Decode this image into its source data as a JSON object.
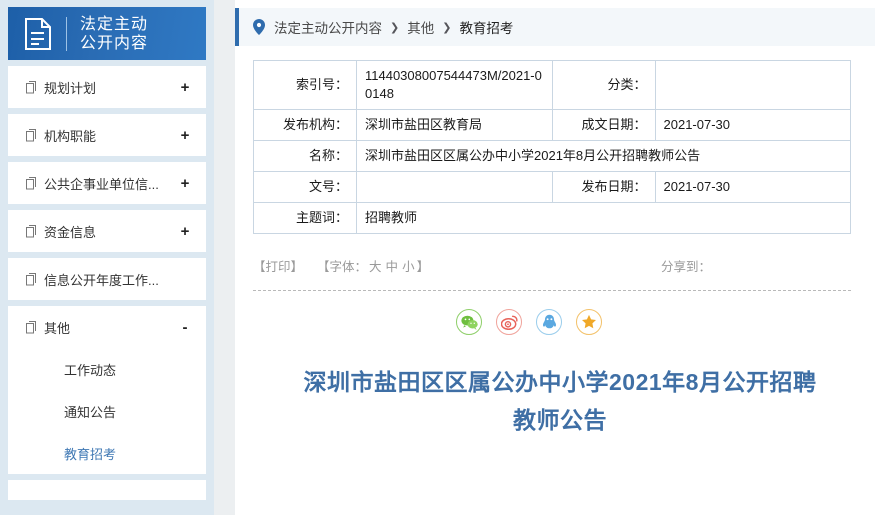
{
  "sidebar": {
    "header": {
      "icon": "document-icon",
      "title": "法定主动\n公开内容"
    },
    "items": [
      {
        "label": "规划计划",
        "icon": "pages-icon",
        "toggle": "+"
      },
      {
        "label": "机构职能",
        "icon": "pages-icon",
        "toggle": "+"
      },
      {
        "label": "公共企事业单位信...",
        "icon": "pages-icon",
        "toggle": "+"
      },
      {
        "label": "资金信息",
        "icon": "pages-icon",
        "toggle": "+"
      },
      {
        "label": "信息公开年度工作...",
        "icon": "pages-icon",
        "toggle": ""
      },
      {
        "label": "其他",
        "icon": "pages-icon",
        "toggle": "-"
      }
    ],
    "subitems": [
      {
        "label": "工作动态",
        "active": false
      },
      {
        "label": "通知公告",
        "active": false
      },
      {
        "label": "教育招考",
        "active": true
      }
    ]
  },
  "breadcrumb": {
    "pin_icon": "location-pin-icon",
    "items": [
      "法定主动公开内容",
      "其他",
      "教育招考"
    ],
    "separator": "❯"
  },
  "meta_table": {
    "rows": [
      {
        "left_label": "索引号：",
        "left_value": "11440308007544473M/2021-00148",
        "right_label": "分类：",
        "right_value": "",
        "split": true
      },
      {
        "left_label": "发布机构：",
        "left_value": "深圳市盐田区教育局",
        "right_label": "成文日期：",
        "right_value": "2021-07-30",
        "split": true
      },
      {
        "left_label": "名称：",
        "left_value": "深圳市盐田区区属公办中小学2021年8月公开招聘教师公告",
        "right_label": "",
        "right_value": "",
        "split": false
      },
      {
        "left_label": "文号：",
        "left_value": "",
        "right_label": "发布日期：",
        "right_value": "2021-07-30",
        "split": true
      },
      {
        "left_label": "主题词：",
        "left_value": "招聘教师",
        "right_label": "",
        "right_value": "",
        "split": false
      }
    ]
  },
  "toolbar": {
    "print": "【打印】",
    "font_prefix": "【字体：",
    "font_large": "大",
    "font_medium": "中",
    "font_small": "小",
    "font_suffix": "】",
    "share_to": "分享到："
  },
  "share_icons": [
    {
      "name": "wechat-icon",
      "color": "#6fbf3f"
    },
    {
      "name": "weibo-icon",
      "color": "#e8635a"
    },
    {
      "name": "qq-icon",
      "color": "#5aa8e0"
    },
    {
      "name": "favorite-star-icon",
      "color": "#f0a828"
    }
  ],
  "article": {
    "title": "深圳市盐田区区属公办中小学2021年8月公开招聘教师公告"
  },
  "colors": {
    "sidebar_bg": "#dce8f1",
    "header_blue": "#2a6cb4",
    "accent_blue": "#2f6cad",
    "title_blue": "#3f6fa5",
    "table_border": "#c9d6e2"
  }
}
